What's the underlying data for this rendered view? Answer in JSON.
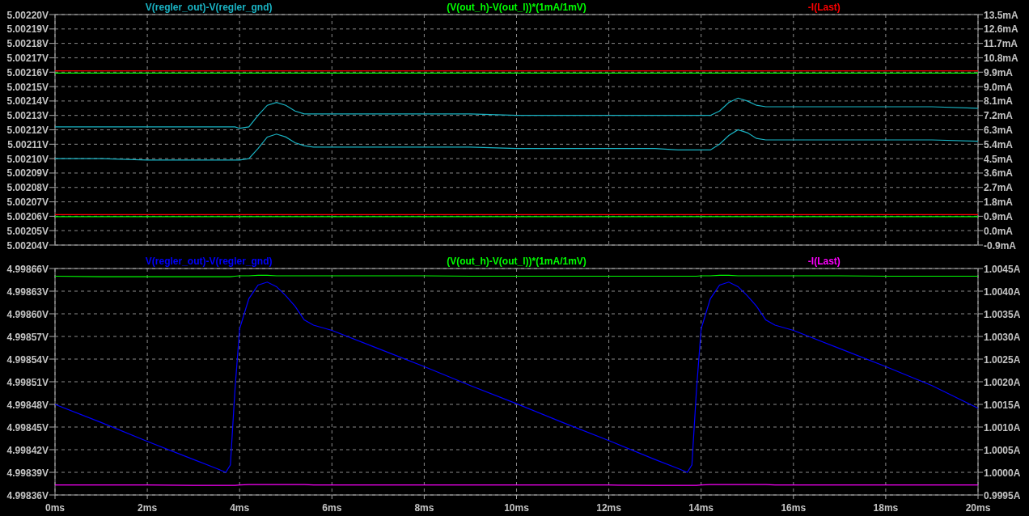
{
  "panes": [
    {
      "chart_data": {
        "type": "line",
        "grid": true,
        "xlim": [
          0,
          20
        ],
        "x": [
          0,
          1,
          2,
          3,
          3.5,
          3.7,
          3.8,
          3.9,
          4,
          4.2,
          4.4,
          4.6,
          4.8,
          5,
          5.2,
          5.4,
          5.6,
          6,
          7,
          8,
          9,
          10,
          11,
          12,
          13,
          13.5,
          13.7,
          13.8,
          13.9,
          14,
          14.2,
          14.4,
          14.6,
          14.8,
          15,
          15.2,
          15.4,
          15.6,
          16,
          17,
          18,
          19,
          20
        ],
        "ylim": [
          5.00204,
          5.0022
        ],
        "yticks": [
          {
            "value": 5.0022,
            "label": "5.00220V"
          },
          {
            "value": 5.00219,
            "label": "5.00219V"
          },
          {
            "value": 5.00218,
            "label": "5.00218V"
          },
          {
            "value": 5.00217,
            "label": "5.00217V"
          },
          {
            "value": 5.00216,
            "label": "5.00216V"
          },
          {
            "value": 5.00215,
            "label": "5.00215V"
          },
          {
            "value": 5.00214,
            "label": "5.00214V"
          },
          {
            "value": 5.00213,
            "label": "5.00213V"
          },
          {
            "value": 5.00212,
            "label": "5.00212V"
          },
          {
            "value": 5.00211,
            "label": "5.00211V"
          },
          {
            "value": 5.0021,
            "label": "5.00210V"
          },
          {
            "value": 5.00209,
            "label": "5.00209V"
          },
          {
            "value": 5.00208,
            "label": "5.00208V"
          },
          {
            "value": 5.00207,
            "label": "5.00207V"
          },
          {
            "value": 5.00206,
            "label": "5.00206V"
          },
          {
            "value": 5.00205,
            "label": "5.00205V"
          },
          {
            "value": 5.00204,
            "label": "5.00204V"
          }
        ],
        "y2lim": [
          -0.9,
          13.5
        ],
        "y2ticks": [
          {
            "value": 13.5,
            "label": "13.5mA"
          },
          {
            "value": 12.6,
            "label": "12.6mA"
          },
          {
            "value": 11.7,
            "label": "11.7mA"
          },
          {
            "value": 10.8,
            "label": "10.8mA"
          },
          {
            "value": 9.9,
            "label": "9.9mA"
          },
          {
            "value": 9.0,
            "label": "9.0mA"
          },
          {
            "value": 8.1,
            "label": "8.1mA"
          },
          {
            "value": 7.2,
            "label": "7.2mA"
          },
          {
            "value": 6.3,
            "label": "6.3mA"
          },
          {
            "value": 5.4,
            "label": "5.4mA"
          },
          {
            "value": 4.5,
            "label": "4.5mA"
          },
          {
            "value": 3.6,
            "label": "3.6mA"
          },
          {
            "value": 2.7,
            "label": "2.7mA"
          },
          {
            "value": 1.8,
            "label": "1.8mA"
          },
          {
            "value": 0.9,
            "label": "0.9mA"
          },
          {
            "value": 0.0,
            "label": "0.0mA"
          },
          {
            "value": -0.9,
            "label": "-0.9mA"
          }
        ],
        "series": [
          {
            "name": "V(regler_out)-V(regler_gnd)",
            "color": "#1ab4c4",
            "values": [
              5.002122,
              5.002122,
              5.002122,
              5.002122,
              5.002122,
              5.002122,
              5.002122,
              5.002122,
              5.002121,
              5.002122,
              5.00213,
              5.002137,
              5.002139,
              5.002137,
              5.002133,
              5.002131,
              5.002131,
              5.002131,
              5.002131,
              5.002131,
              5.002131,
              5.00213,
              5.00213,
              5.00213,
              5.00213,
              5.00213,
              5.00213,
              5.00213,
              5.00213,
              5.00213,
              5.00213,
              5.002133,
              5.002139,
              5.002142,
              5.00214,
              5.002137,
              5.002136,
              5.002136,
              5.002136,
              5.002136,
              5.002136,
              5.002136,
              5.002135
            ]
          },
          {
            "color": "#1ab4c4",
            "values": [
              5.0021,
              5.0021,
              5.002099,
              5.002099,
              5.002099,
              5.002099,
              5.002099,
              5.002099,
              5.002099,
              5.0021,
              5.002107,
              5.002115,
              5.002117,
              5.002115,
              5.002111,
              5.002109,
              5.002108,
              5.002108,
              5.002108,
              5.002108,
              5.002108,
              5.002107,
              5.002107,
              5.002107,
              5.002107,
              5.002106,
              5.002106,
              5.002106,
              5.002106,
              5.002106,
              5.002106,
              5.00211,
              5.002116,
              5.00212,
              5.002118,
              5.002114,
              5.002113,
              5.002113,
              5.002113,
              5.002113,
              5.002113,
              5.002113,
              5.002112
            ]
          },
          {
            "name": "(V(out_h)-V(out_l))*(1mA/1mV)",
            "color": "#00ff00",
            "axis": "y2",
            "values": [
              9.84,
              9.84,
              9.84,
              9.84,
              9.84,
              9.84,
              9.84,
              9.84,
              9.84,
              9.84,
              9.84,
              9.84,
              9.84,
              9.84,
              9.84,
              9.84,
              9.84,
              9.84,
              9.84,
              9.84,
              9.84,
              9.84,
              9.84,
              9.84,
              9.84,
              9.84,
              9.84,
              9.84,
              9.84,
              9.84,
              9.84,
              9.84,
              9.84,
              9.84,
              9.84,
              9.84,
              9.84,
              9.84,
              9.84,
              9.84,
              9.84,
              9.84,
              9.84
            ]
          },
          {
            "color": "#00ff00",
            "axis": "y2",
            "values": [
              0.88,
              0.88,
              0.88,
              0.88,
              0.88,
              0.88,
              0.88,
              0.88,
              0.88,
              0.88,
              0.88,
              0.88,
              0.88,
              0.88,
              0.88,
              0.88,
              0.88,
              0.88,
              0.88,
              0.88,
              0.88,
              0.88,
              0.88,
              0.88,
              0.88,
              0.88,
              0.88,
              0.88,
              0.88,
              0.88,
              0.88,
              0.88,
              0.88,
              0.88,
              0.88,
              0.88,
              0.88,
              0.88,
              0.88,
              0.88,
              0.88,
              0.88,
              0.88
            ]
          },
          {
            "name": "-I(Last)",
            "color": "#ff0000",
            "axis": "y2",
            "values": [
              9.98,
              9.98,
              9.98,
              9.98,
              9.98,
              9.98,
              9.98,
              9.98,
              9.98,
              9.98,
              9.98,
              9.98,
              9.98,
              9.98,
              9.98,
              9.98,
              9.98,
              9.98,
              9.98,
              9.98,
              9.98,
              9.98,
              9.98,
              9.98,
              9.98,
              9.98,
              9.98,
              9.98,
              9.98,
              9.98,
              9.98,
              9.98,
              9.98,
              9.98,
              9.98,
              9.98,
              9.98,
              9.98,
              9.98,
              9.98,
              9.98,
              9.98,
              9.98
            ]
          },
          {
            "color": "#ff0000",
            "axis": "y2",
            "values": [
              1.0,
              1.0,
              1.0,
              1.0,
              1.0,
              1.0,
              1.0,
              1.0,
              1.0,
              1.0,
              1.0,
              1.0,
              1.0,
              1.0,
              1.0,
              1.0,
              1.0,
              1.0,
              1.0,
              1.0,
              1.0,
              1.0,
              1.0,
              1.0,
              1.0,
              1.0,
              1.0,
              1.0,
              1.0,
              1.0,
              1.0,
              1.0,
              1.0,
              1.0,
              1.0,
              1.0,
              1.0,
              1.0,
              1.0,
              1.0,
              1.0,
              1.0,
              1.0
            ]
          }
        ]
      }
    },
    {
      "chart_data": {
        "type": "line",
        "grid": true,
        "xlim": [
          0,
          20
        ],
        "xticks": [
          {
            "value": 0,
            "label": "0ms"
          },
          {
            "value": 2,
            "label": "2ms"
          },
          {
            "value": 4,
            "label": "4ms"
          },
          {
            "value": 6,
            "label": "6ms"
          },
          {
            "value": 8,
            "label": "8ms"
          },
          {
            "value": 10,
            "label": "10ms"
          },
          {
            "value": 12,
            "label": "12ms"
          },
          {
            "value": 14,
            "label": "14ms"
          },
          {
            "value": 16,
            "label": "16ms"
          },
          {
            "value": 18,
            "label": "18ms"
          },
          {
            "value": 20,
            "label": "20ms"
          }
        ],
        "x": [
          0,
          1,
          2,
          3,
          3.5,
          3.7,
          3.8,
          3.9,
          4,
          4.2,
          4.4,
          4.6,
          4.8,
          5,
          5.2,
          5.4,
          5.6,
          6,
          7,
          8,
          9,
          10,
          11,
          12,
          13,
          13.5,
          13.7,
          13.8,
          13.9,
          14,
          14.2,
          14.4,
          14.6,
          14.8,
          15,
          15.2,
          15.4,
          15.6,
          16,
          17,
          18,
          19,
          20
        ],
        "ylim": [
          4.99836,
          4.99866
        ],
        "yticks": [
          {
            "value": 4.99866,
            "label": "4.99866V"
          },
          {
            "value": 4.99863,
            "label": "4.99863V"
          },
          {
            "value": 4.9986,
            "label": "4.99860V"
          },
          {
            "value": 4.99857,
            "label": "4.99857V"
          },
          {
            "value": 4.99854,
            "label": "4.99854V"
          },
          {
            "value": 4.99851,
            "label": "4.99851V"
          },
          {
            "value": 4.99848,
            "label": "4.99848V"
          },
          {
            "value": 4.99845,
            "label": "4.99845V"
          },
          {
            "value": 4.99842,
            "label": "4.99842V"
          },
          {
            "value": 4.99839,
            "label": "4.99839V"
          },
          {
            "value": 4.99836,
            "label": "4.99836V"
          }
        ],
        "y2lim": [
          0.9995,
          1.0045
        ],
        "y2ticks": [
          {
            "value": 1.0045,
            "label": "1.0045A"
          },
          {
            "value": 1.004,
            "label": "1.0040A"
          },
          {
            "value": 1.0035,
            "label": "1.0035A"
          },
          {
            "value": 1.003,
            "label": "1.0030A"
          },
          {
            "value": 1.0025,
            "label": "1.0025A"
          },
          {
            "value": 1.002,
            "label": "1.0020A"
          },
          {
            "value": 1.0015,
            "label": "1.0015A"
          },
          {
            "value": 1.001,
            "label": "1.0010A"
          },
          {
            "value": 1.0005,
            "label": "1.0005A"
          },
          {
            "value": 1.0,
            "label": "1.0000A"
          },
          {
            "value": 0.9995,
            "label": "0.9995A"
          }
        ],
        "series": [
          {
            "name": "V(regler_out)-V(regler_gnd)",
            "color": "#0000ff",
            "values": [
              4.99848,
              4.998456,
              4.998431,
              4.998407,
              4.998395,
              4.99839,
              4.9984,
              4.9985,
              4.99858,
              4.99862,
              4.998638,
              4.998642,
              4.998636,
              4.998624,
              4.99861,
              4.998592,
              4.998585,
              4.998578,
              4.998554,
              4.99853,
              4.998505,
              4.998481,
              4.998456,
              4.998432,
              4.998407,
              4.998395,
              4.99839,
              4.9984,
              4.9985,
              4.99858,
              4.99862,
              4.998638,
              4.998642,
              4.998636,
              4.998624,
              4.99861,
              4.998592,
              4.998585,
              4.998578,
              4.998554,
              4.99853,
              4.998505,
              4.998475
            ]
          },
          {
            "name": "(V(out_h)-V(out_l))*(1mA/1mV)",
            "color": "#00ff00",
            "axis": "y2",
            "values": [
              1.00433,
              1.00432,
              1.00432,
              1.00432,
              1.00432,
              1.00432,
              1.00432,
              1.00433,
              1.00434,
              1.00434,
              1.00435,
              1.00435,
              1.00434,
              1.00434,
              1.00434,
              1.00434,
              1.00434,
              1.00434,
              1.00434,
              1.00434,
              1.00433,
              1.00433,
              1.00433,
              1.00433,
              1.00433,
              1.00433,
              1.00433,
              1.00433,
              1.00433,
              1.00434,
              1.00434,
              1.00435,
              1.00435,
              1.00434,
              1.00434,
              1.00434,
              1.00434,
              1.00434,
              1.00434,
              1.00434,
              1.00433,
              1.00433,
              1.00433
            ]
          },
          {
            "name": "-I(Last)",
            "color": "#ff00ff",
            "axis": "y2",
            "values": [
              0.99972,
              0.99972,
              0.99972,
              0.99971,
              0.99971,
              0.99971,
              0.99971,
              0.99971,
              0.99972,
              0.99973,
              0.99973,
              0.99973,
              0.99973,
              0.99973,
              0.99973,
              0.99973,
              0.99972,
              0.99972,
              0.99972,
              0.99972,
              0.99972,
              0.99972,
              0.99972,
              0.99972,
              0.99971,
              0.99971,
              0.99971,
              0.99971,
              0.99971,
              0.99972,
              0.99973,
              0.99973,
              0.99973,
              0.99973,
              0.99973,
              0.99973,
              0.99973,
              0.99972,
              0.99972,
              0.99972,
              0.99972,
              0.99972,
              0.99972
            ]
          }
        ]
      }
    }
  ]
}
